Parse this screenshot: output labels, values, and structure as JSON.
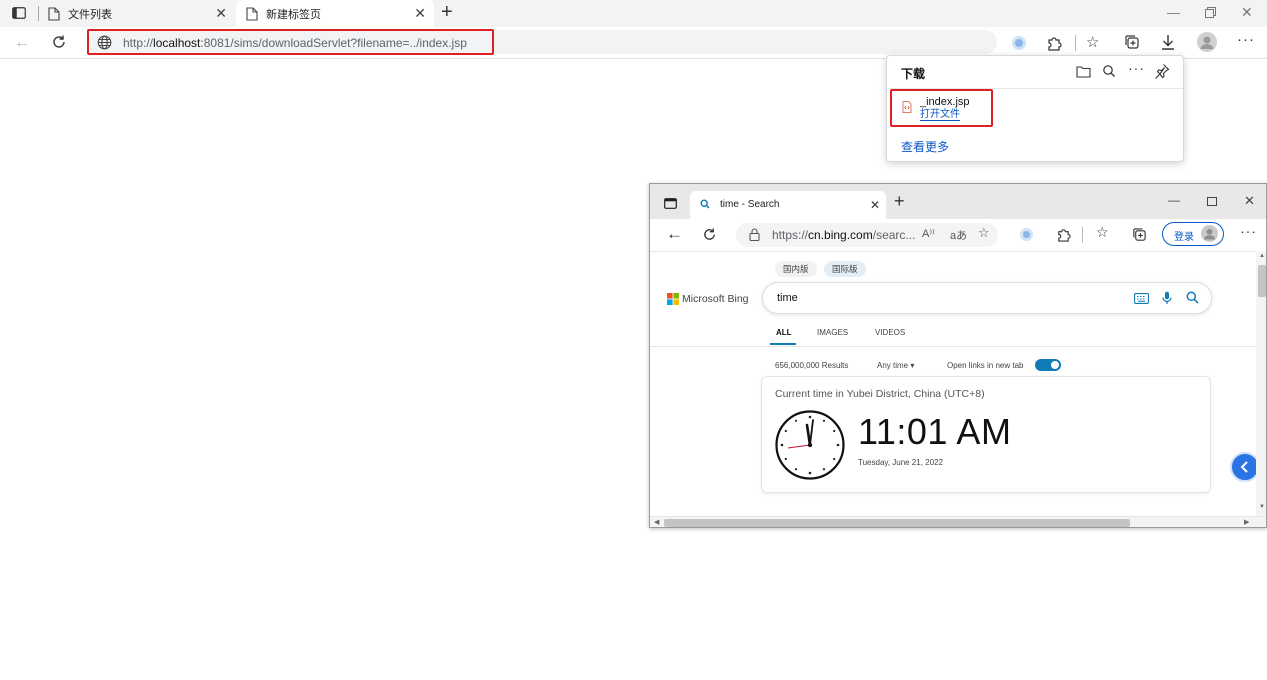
{
  "browser": {
    "tabs": [
      {
        "title": "文件列表"
      },
      {
        "title": "新建标签页"
      }
    ],
    "address": {
      "url_prefix": "http://",
      "url_host": "localhost",
      "url_rest": ":8081/sims/downloadServlet?filename=../index.jsp"
    }
  },
  "downloads": {
    "title": "下载",
    "item": {
      "filename": "_index.jsp",
      "open_label": "打开文件"
    },
    "more_label": "查看更多"
  },
  "embedded_window": {
    "tab_title": "time - Search",
    "url_prefix": "https://",
    "url_host": "cn.bing.com",
    "url_rest": "/searc...",
    "login_label": "登录",
    "bing": {
      "region_pills": [
        "国内版",
        "国际版"
      ],
      "logo_text": "Microsoft Bing",
      "query": "time",
      "tabs": [
        "ALL",
        "IMAGES",
        "VIDEOS"
      ],
      "results_count": "656,000,000 Results",
      "time_filter": "Any time",
      "new_tab_label": "Open links in new tab",
      "card": {
        "title": "Current time in Yubei District, China (UTC+8)",
        "time": "11:01 AM",
        "date": "Tuesday, June 21, 2022"
      }
    }
  },
  "colors": {
    "highlight_box": "#e02020",
    "link_blue": "#0a58ca",
    "bing_accent": "#117bb8"
  }
}
